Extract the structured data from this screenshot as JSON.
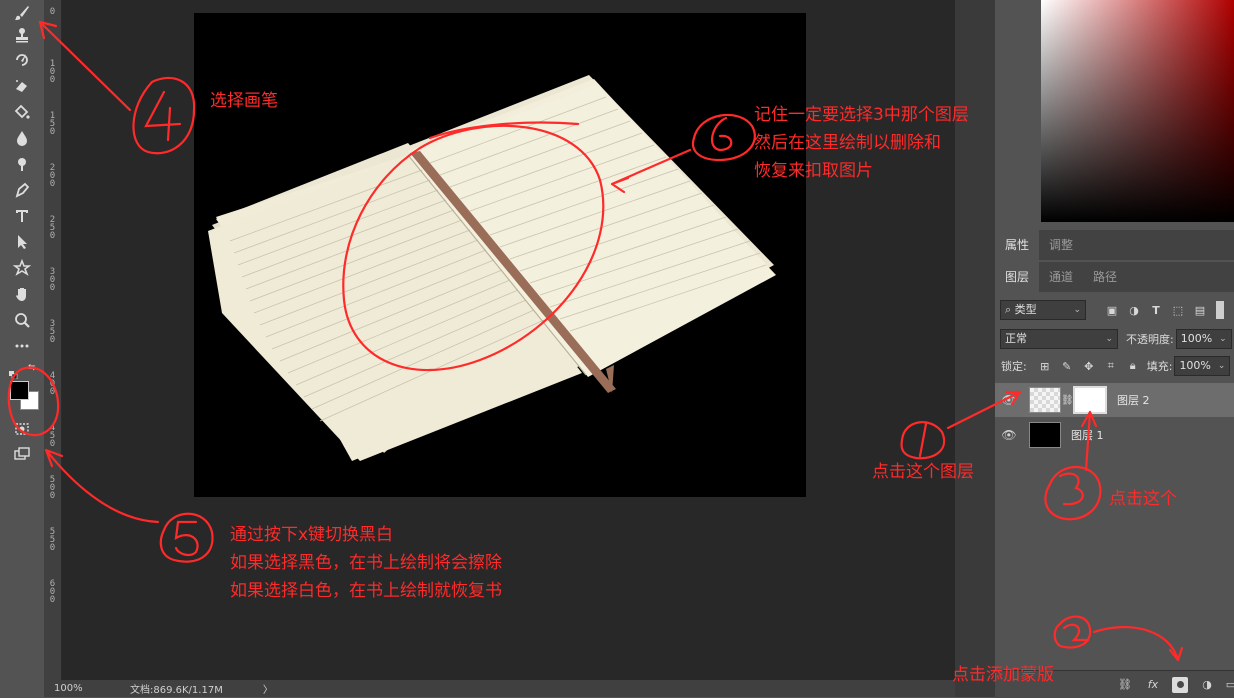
{
  "statusbar": {
    "zoom": "100%",
    "doc_info": "文档:869.6K/1.17M",
    "arrow": "〉"
  },
  "panels": {
    "tabs_top": [
      {
        "label": "属性"
      },
      {
        "label": "调整"
      }
    ],
    "tabs_layers": [
      {
        "label": "图层"
      },
      {
        "label": "通道"
      },
      {
        "label": "路径"
      }
    ],
    "filter": {
      "label": "类型",
      "icon_names": [
        "image-filter-icon",
        "adjustment-filter-icon",
        "type-filter-icon",
        "shape-filter-icon",
        "smart-object-filter-icon"
      ]
    },
    "blend_mode": "正常",
    "opacity_label": "不透明度:",
    "opacity_value": "100%",
    "lock_label": "锁定:",
    "fill_label": "填充:",
    "fill_value": "100%",
    "layers": [
      {
        "name": "图层 2",
        "selected": true
      },
      {
        "name": "图层 1",
        "selected": false
      }
    ]
  },
  "ruler": {
    "ticks": [
      "0",
      "1\n0\n0",
      "1\n5\n0",
      "2\n0\n0",
      "2\n5\n0",
      "3\n0\n0",
      "3\n5\n0",
      "4\n0\n0",
      "4\n5\n0",
      "5\n0\n0",
      "5\n5\n0",
      "6\n0\n0"
    ]
  },
  "annotations": {
    "step4": "选择画笔",
    "step6_lines": [
      "记住一定要选择3中那个图层",
      "然后在这里绘制以删除和",
      "恢复来扣取图片"
    ],
    "step1": "点击这个图层",
    "step3": "点击这个",
    "step2": "点击添加蒙版",
    "step5_lines": [
      "通过按下x键切换黑白",
      "如果选择黑色，在书上绘制将会擦除",
      "如果选择白色，在书上绘制就恢复书"
    ]
  },
  "colors": {
    "annotation": "#ff2a2a",
    "foreground": "#000000",
    "background": "#ffffff"
  }
}
